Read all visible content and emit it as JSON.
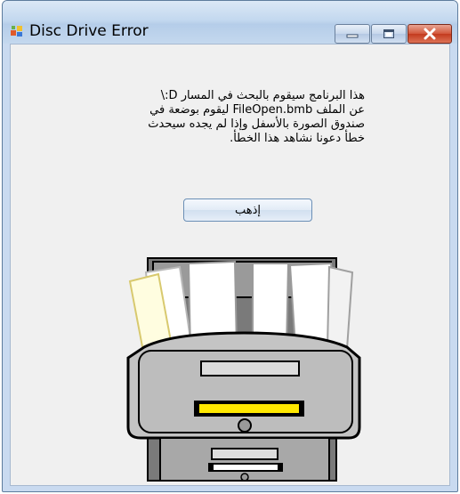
{
  "window": {
    "title": "Disc Drive Error",
    "controls": {
      "minimize": "minimize",
      "maximize": "maximize",
      "close": "close"
    }
  },
  "message": {
    "text": "هذا البرنامج سيقوم بالبحث في المسار D:\\\nعن الملف FileOpen.bmb ليقوم بوضعة في\nصندوق الصورة بالأسفل وإذا لم يجده سيحدث\nخطأ دعونا نشاهد هذا الخطأ."
  },
  "go_button": {
    "label": "إذهب"
  },
  "icons": {
    "app": "app-window-icon",
    "minimize": "minimize-icon",
    "maximize": "maximize-icon",
    "close": "close-icon",
    "illustration": "file-cabinet-illustration"
  },
  "colors": {
    "titlebar": "#c3d8ef",
    "client_bg": "#f0f0f0",
    "close_button": "#c33a1e",
    "drawer_label": "#ffe800"
  }
}
